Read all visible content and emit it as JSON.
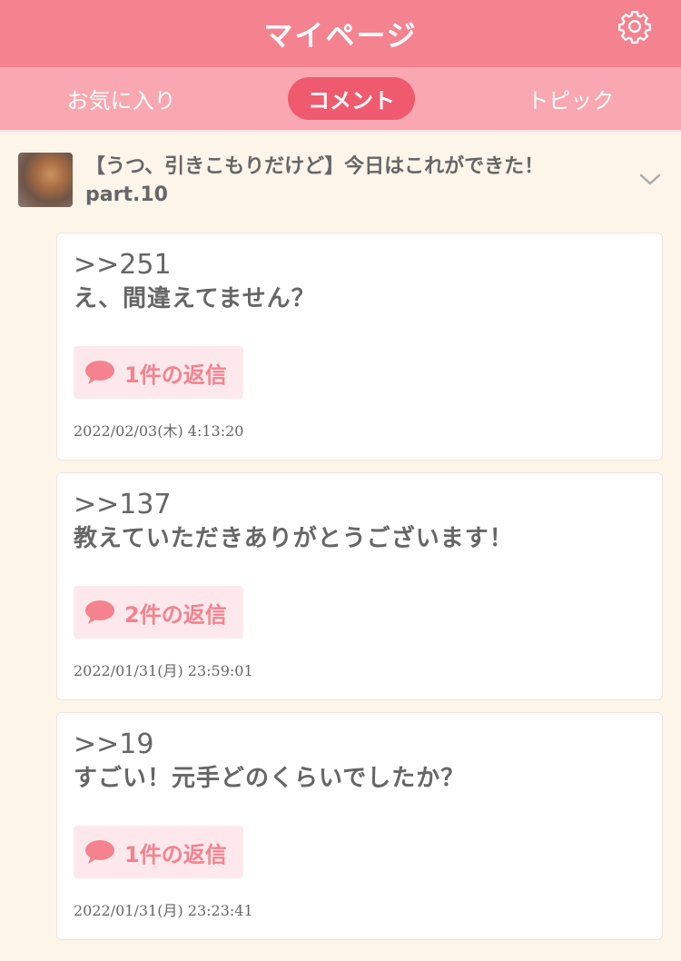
{
  "header": {
    "title": "マイページ",
    "settings_icon": "gear-icon"
  },
  "tabs": [
    {
      "label": "お気に入り",
      "active": false
    },
    {
      "label": "コメント",
      "active": true
    },
    {
      "label": "トピック",
      "active": false
    }
  ],
  "topic": {
    "title": "【うつ、引きこもりだけど】今日はこれができた！part.10",
    "expand_icon": "chevron-down-icon"
  },
  "comments": [
    {
      "anchor": ">>251",
      "text": "え、間違えてません？",
      "reply_label": "1件の返信",
      "timestamp": "2022/02/03(木) 4:13:20"
    },
    {
      "anchor": ">>137",
      "text": "教えていただきありがとうございます！",
      "reply_label": "2件の返信",
      "timestamp": "2022/01/31(月) 23:59:01"
    },
    {
      "anchor": ">>19",
      "text": "すごい！元手どのくらいでしたか？",
      "reply_label": "1件の返信",
      "timestamp": "2022/01/31(月) 23:23:41"
    }
  ],
  "colors": {
    "accent": "#f4828f",
    "tab_bar": "#f9a7b0",
    "active_tab": "#f05a6e",
    "background": "#fdf4ea"
  }
}
